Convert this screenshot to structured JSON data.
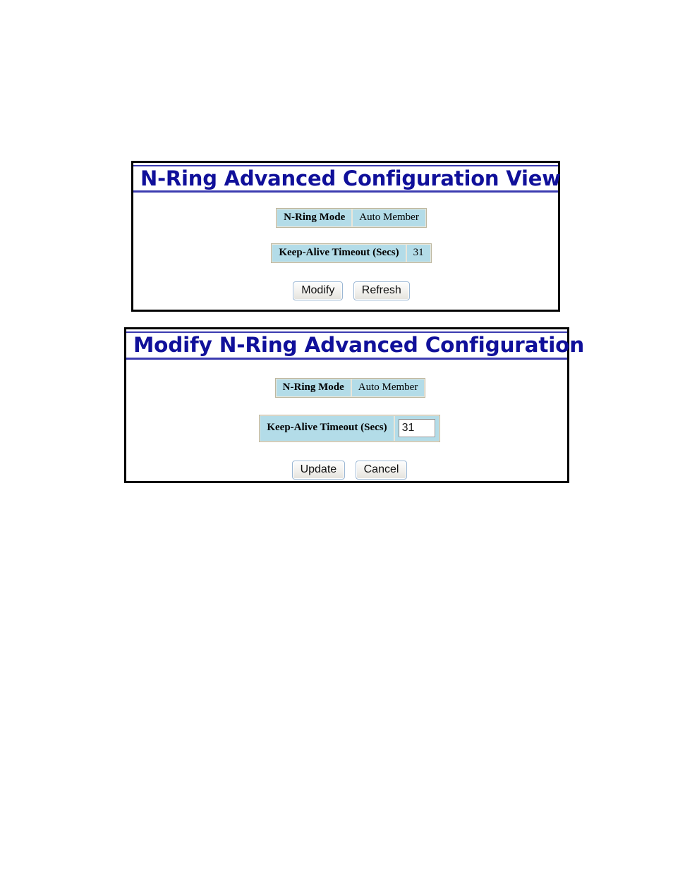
{
  "page": {
    "background": "#ffffff",
    "title_color": "#10109a",
    "cell_background": "#b3dce8",
    "cell_border": "#e9e6da",
    "table_outer_border": "#bdb79f",
    "panel_border": "#000000"
  },
  "panels": [
    {
      "id": "n-ring-advanced-configuration-view",
      "title": "N-Ring Advanced Configuration View",
      "rows": [
        {
          "label": "N-Ring Mode",
          "value": "Auto Member",
          "type": "text"
        },
        {
          "label": "Keep-Alive Timeout (Secs)",
          "value": "31",
          "type": "text"
        }
      ],
      "buttons": [
        {
          "id": "modify",
          "label": "Modify"
        },
        {
          "id": "refresh",
          "label": "Refresh"
        }
      ]
    },
    {
      "id": "modify-n-ring-advanced-configuration",
      "title": "Modify N-Ring Advanced Configuration",
      "rows": [
        {
          "label": "N-Ring Mode",
          "value": "Auto Member",
          "type": "text"
        },
        {
          "label": "Keep-Alive Timeout (Secs)",
          "value": "31",
          "type": "input",
          "placeholder": ""
        }
      ],
      "buttons": [
        {
          "id": "update",
          "label": "Update"
        },
        {
          "id": "cancel",
          "label": "Cancel"
        }
      ]
    }
  ]
}
